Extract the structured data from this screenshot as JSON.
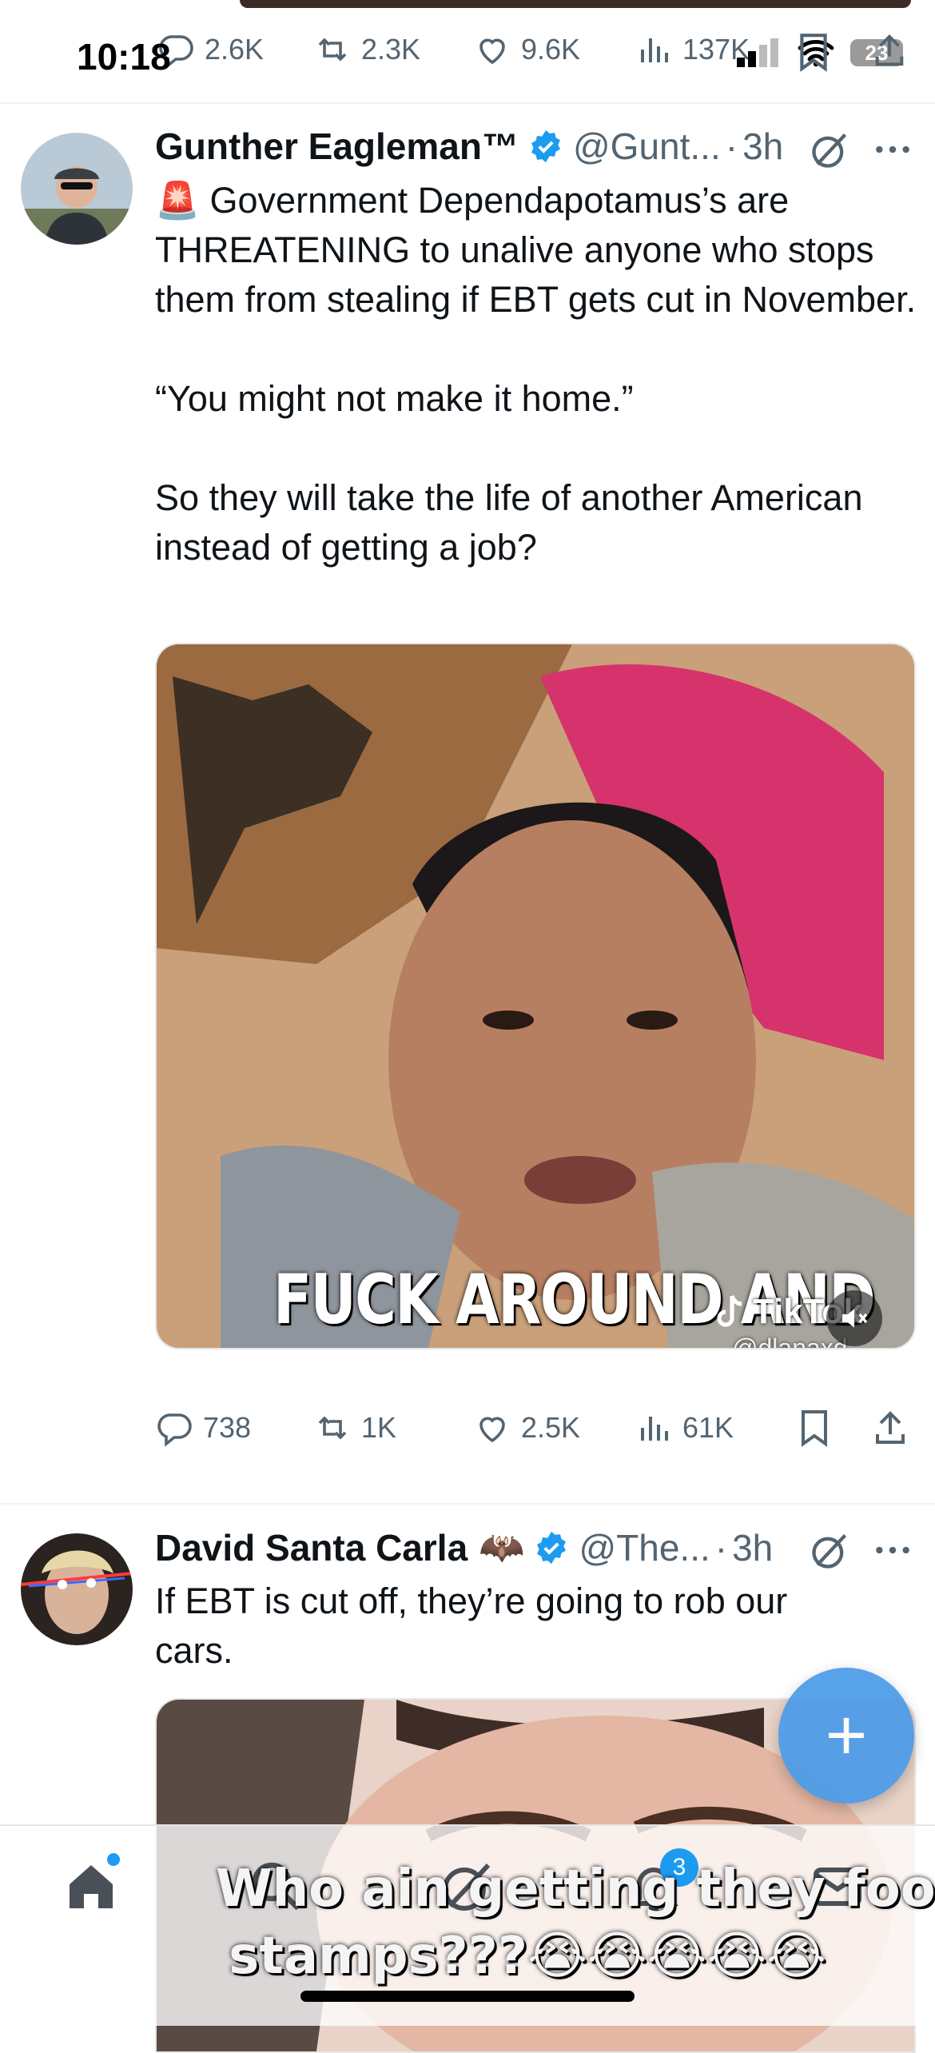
{
  "status_bar": {
    "time": "10:18",
    "battery": "23"
  },
  "prev_tweet_actions": {
    "replies": "2.6K",
    "reposts": "2.3K",
    "likes": "9.6K",
    "views": "137K"
  },
  "tweets": [
    {
      "name": "Gunther Eagleman™",
      "handle": "@Gunt...",
      "time": "3h",
      "text": "🚨 Government Dependapotamus’s are THREATENING to unalive anyone who stops them from stealing if EBT gets cut in November.\n\n“You might not make it home.”\n\nSo they will take the life of another American instead of getting a job?",
      "media_caption": "FUCK AROUND AND",
      "media_watermark": "TikTok",
      "media_watermark_handle": "@dlanaxd",
      "actions": {
        "replies": "738",
        "reposts": "1K",
        "likes": "2.5K",
        "views": "61K"
      }
    },
    {
      "name": "David Santa Carla",
      "name_emoji": "🦇",
      "handle": "@The...",
      "time": "3h",
      "text": "If EBT is cut off, they’re going to rob our cars.",
      "media_caption_line1": "Who ain getting they food",
      "media_caption_line2": "stamps???😭😭😭😭😭"
    }
  ],
  "fab": {
    "label": "+"
  },
  "tabbar": {
    "notifications_badge": "3"
  },
  "colors": {
    "accent": "#1d9bf0",
    "text": "#0f1419",
    "muted": "#536471"
  },
  "icons": [
    "home-icon",
    "search-icon",
    "grok-icon",
    "notifications-icon",
    "messages-icon",
    "reply-icon",
    "repost-icon",
    "like-icon",
    "views-icon",
    "bookmark-icon",
    "share-icon",
    "verified-badge-icon",
    "grok-logo-icon",
    "more-icon",
    "mute-icon"
  ]
}
